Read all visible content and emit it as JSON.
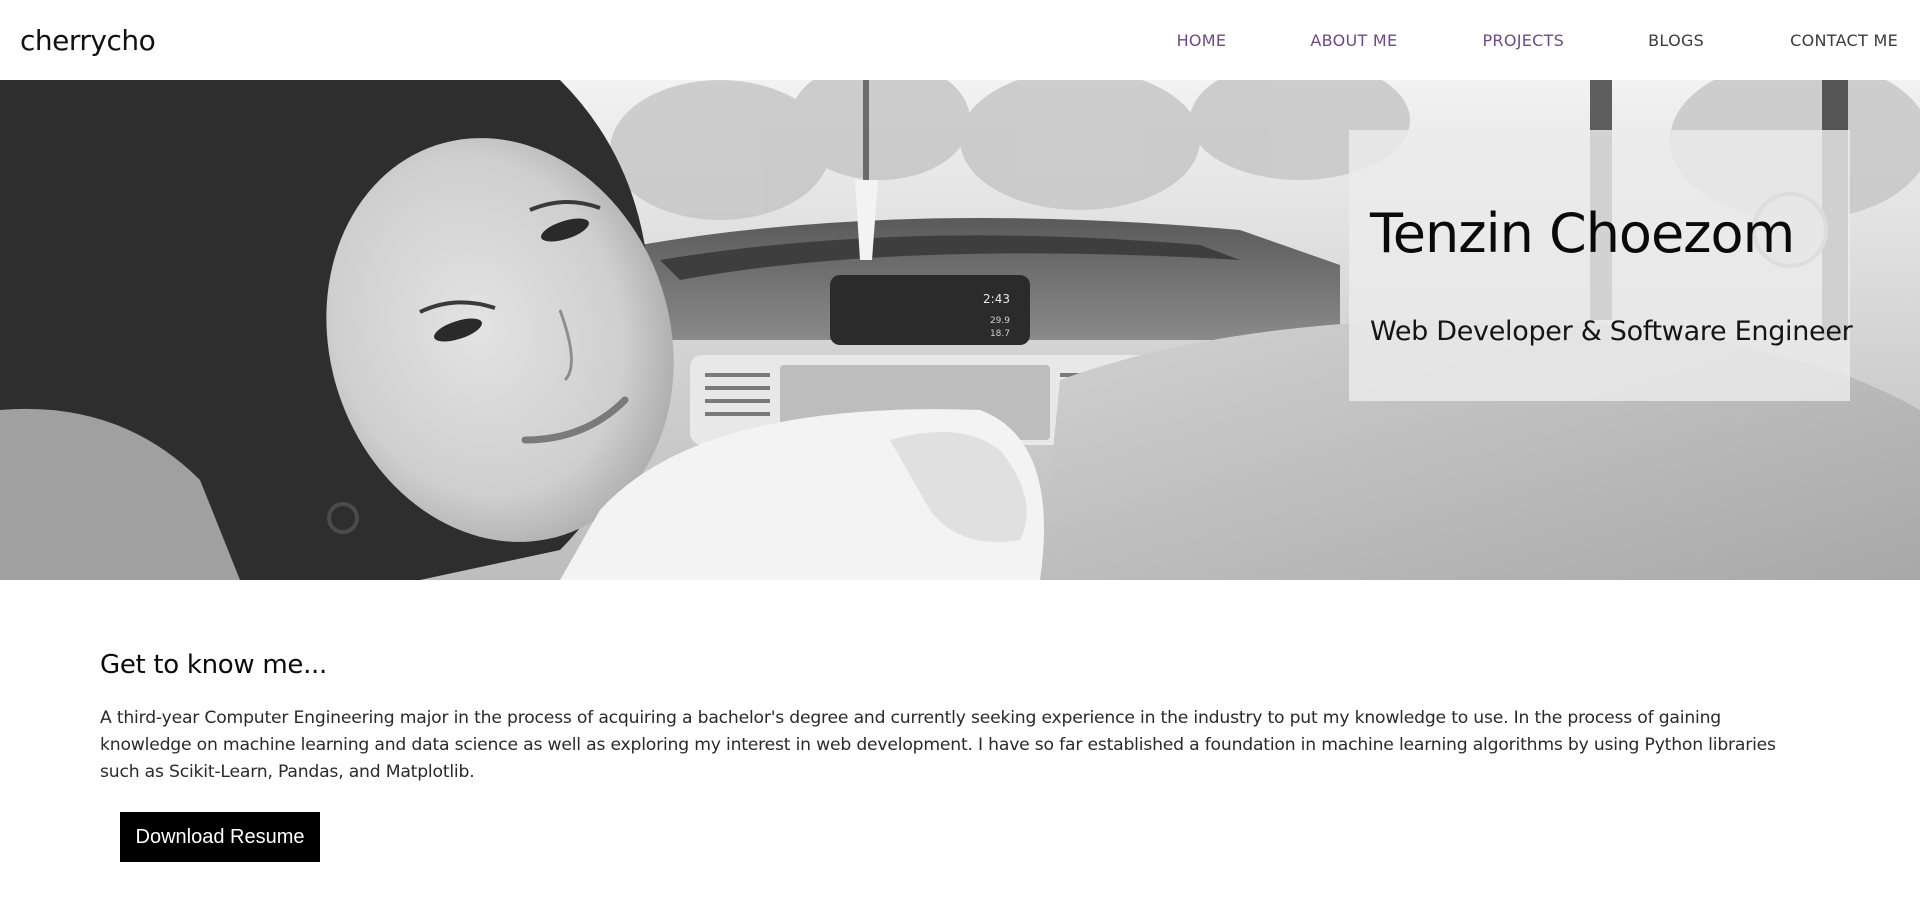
{
  "header": {
    "brand": "cherrycho",
    "nav": [
      {
        "label": "HOME"
      },
      {
        "label": "ABOUT ME"
      },
      {
        "label": "PROJECTS"
      },
      {
        "label": "BLOGS"
      },
      {
        "label": "CONTACT ME"
      }
    ]
  },
  "hero": {
    "name": "Tenzin Choezom",
    "role": "Web Developer & Software Engineer",
    "dashboard": {
      "time": "2:43",
      "readout_1": "29.9",
      "readout_2": "18.7"
    }
  },
  "about": {
    "title": "Get to know me...",
    "text": "A third-year Computer Engineering major in the process of acquiring a bachelor's degree and currently seeking experience in the industry to put my knowledge to use. In the process of gaining knowledge on machine learning and data science as well as exploring my interest in web development. I have so far established a foundation in machine learning algorithms by using Python libraries such as Scikit-Learn, Pandas, and Matplotlib.",
    "button_label": "Download Resume"
  },
  "colors": {
    "nav_active": "#6b4a85",
    "nav_default": "#3a3a3a",
    "button_bg": "#000000",
    "button_text": "#ffffff"
  }
}
